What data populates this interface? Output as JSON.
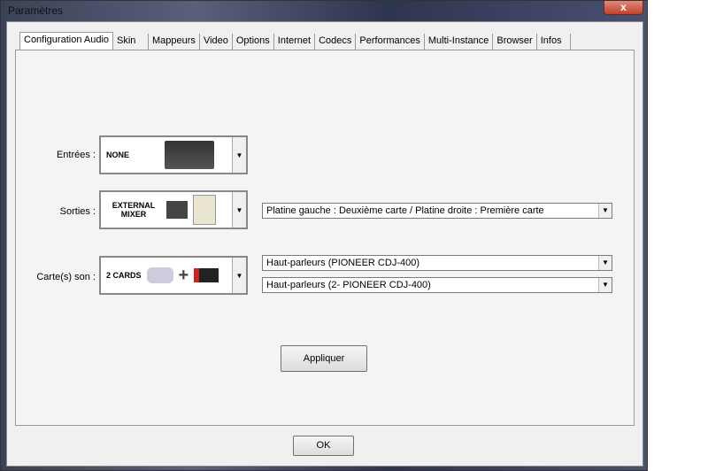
{
  "window": {
    "title": "Paramètres",
    "close": "x"
  },
  "tabs": [
    "Configuration Audio",
    "Skin",
    "Mappeurs",
    "Video",
    "Options",
    "Internet",
    "Codecs",
    "Performances",
    "Multi-Instance",
    "Browser",
    "Infos"
  ],
  "inputs": {
    "label": "Entrées :",
    "value": "NONE"
  },
  "outputs": {
    "label": "Sorties :",
    "value_line1": "EXTERNAL",
    "value_line2": "MIXER",
    "routing": "Platine gauche : Deuxième carte / Platine droite : Première carte"
  },
  "cards": {
    "label": "Carte(s) son :",
    "value": "2 CARDS",
    "card1": "Haut-parleurs (PIONEER CDJ-400)",
    "card2": "Haut-parleurs (2- PIONEER CDJ-400)"
  },
  "apply": "Appliquer",
  "ok": "OK"
}
